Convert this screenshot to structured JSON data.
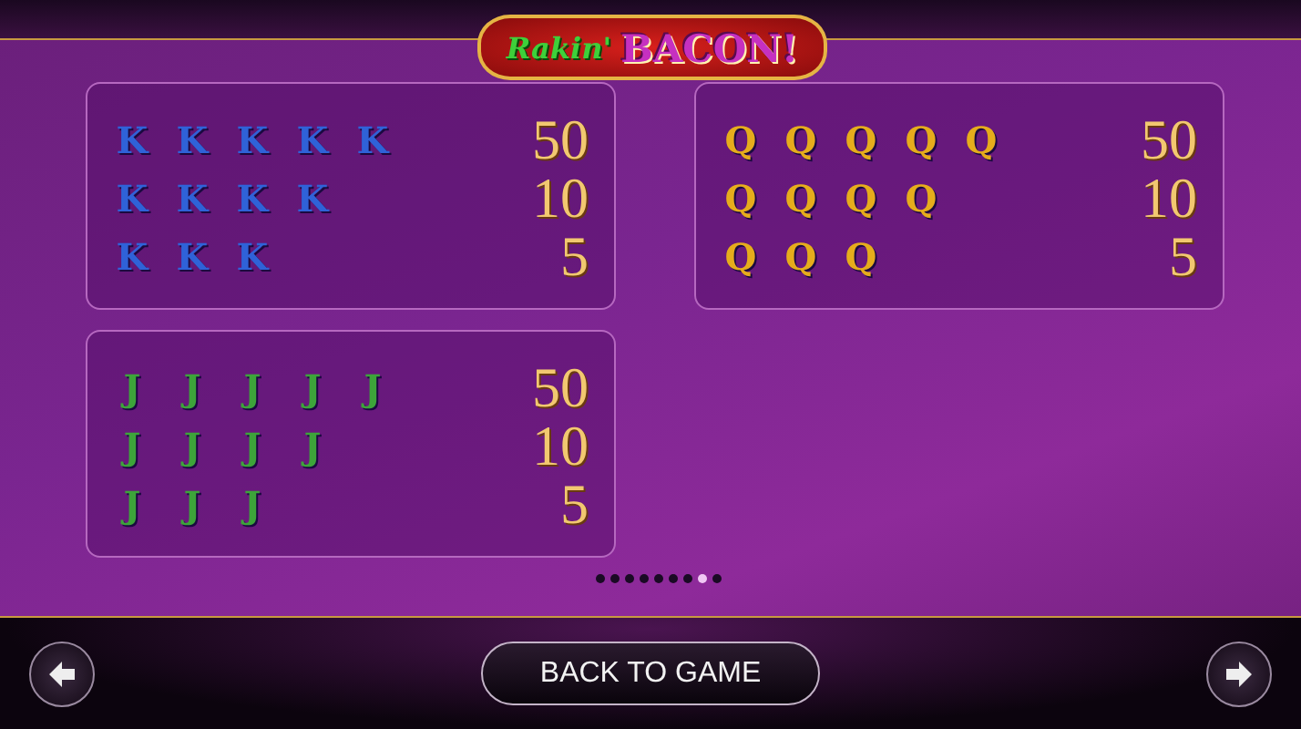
{
  "logo": {
    "script": "Rakin'",
    "word": "BACON!"
  },
  "panels": [
    {
      "color": "#2f62d8",
      "rows": [
        {
          "symbols": [
            "K",
            "K",
            "K",
            "K",
            "K"
          ],
          "payout": "50"
        },
        {
          "symbols": [
            "K",
            "K",
            "K",
            "K"
          ],
          "payout": "10"
        },
        {
          "symbols": [
            "K",
            "K",
            "K"
          ],
          "payout": "5"
        }
      ]
    },
    {
      "color": "#e6ac1c",
      "rows": [
        {
          "symbols": [
            "Q",
            "Q",
            "Q",
            "Q",
            "Q"
          ],
          "payout": "50"
        },
        {
          "symbols": [
            "Q",
            "Q",
            "Q",
            "Q"
          ],
          "payout": "10"
        },
        {
          "symbols": [
            "Q",
            "Q",
            "Q"
          ],
          "payout": "5"
        }
      ]
    },
    {
      "color": "#3da43a",
      "rows": [
        {
          "symbols": [
            "J",
            "J",
            "J",
            "J",
            "J"
          ],
          "payout": "50"
        },
        {
          "symbols": [
            "J",
            "J",
            "J",
            "J"
          ],
          "payout": "10"
        },
        {
          "symbols": [
            "J",
            "J",
            "J"
          ],
          "payout": "5"
        }
      ]
    }
  ],
  "pages": [
    {
      "selected": false
    },
    {
      "selected": false
    },
    {
      "selected": false
    },
    {
      "selected": false
    },
    {
      "selected": false
    },
    {
      "selected": false
    },
    {
      "selected": false
    },
    {
      "selected": true
    },
    {
      "selected": false
    }
  ],
  "back_button": "BACK TO GAME"
}
